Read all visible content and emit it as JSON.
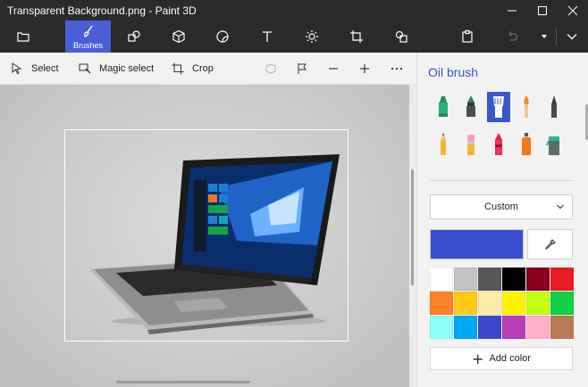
{
  "window": {
    "title": "Transparent Background.png - Paint 3D",
    "controls": [
      "minimize-icon",
      "maximize-icon",
      "close-icon"
    ]
  },
  "toolbar": {
    "items": [
      {
        "name": "menu",
        "icon": "folder-icon"
      },
      {
        "name": "brushes",
        "icon": "brush-icon",
        "label": "Brushes",
        "active": true
      },
      {
        "name": "2d-shapes",
        "icon": "shapes-icon"
      },
      {
        "name": "3d-shapes",
        "icon": "cube-icon"
      },
      {
        "name": "stickers",
        "icon": "sticker-icon"
      },
      {
        "name": "text",
        "icon": "text-icon"
      },
      {
        "name": "effects",
        "icon": "sun-icon"
      },
      {
        "name": "canvas",
        "icon": "canvas-icon"
      },
      {
        "name": "3d-library",
        "icon": "library-icon"
      },
      {
        "name": "paste",
        "icon": "paste-icon"
      },
      {
        "name": "undo",
        "icon": "undo-icon"
      },
      {
        "name": "history",
        "icon": "caret-down-icon"
      },
      {
        "name": "expand",
        "icon": "chevron-down-icon"
      }
    ],
    "accent": "#4a5fd6"
  },
  "subtoolbar": {
    "select_label": "Select",
    "magic_select_label": "Magic select",
    "crop_label": "Crop"
  },
  "panel": {
    "title": "Oil brush",
    "brushes": [
      {
        "name": "marker",
        "selected": false
      },
      {
        "name": "calligraphy-pen",
        "selected": false
      },
      {
        "name": "oil-brush",
        "selected": true
      },
      {
        "name": "watercolor",
        "selected": false
      },
      {
        "name": "pixel-pen",
        "selected": false
      },
      {
        "name": "pencil",
        "selected": false
      },
      {
        "name": "eraser",
        "selected": false
      },
      {
        "name": "crayon",
        "selected": false
      },
      {
        "name": "spray-can",
        "selected": false
      },
      {
        "name": "fill",
        "selected": false
      }
    ],
    "texture_dropdown": "Custom",
    "current_color": "#3a4fd0",
    "palette": [
      "#ffffff",
      "#c3c3c3",
      "#585858",
      "#000000",
      "#88001b",
      "#ec1c24",
      "#ff7f27",
      "#ffca18",
      "#fdeca6",
      "#fff200",
      "#c4ff0e",
      "#0ed145",
      "#8cfffb",
      "#00a8f3",
      "#3f48cc",
      "#b83dba",
      "#ffaec8",
      "#b97a56"
    ],
    "add_color_label": "Add color"
  }
}
